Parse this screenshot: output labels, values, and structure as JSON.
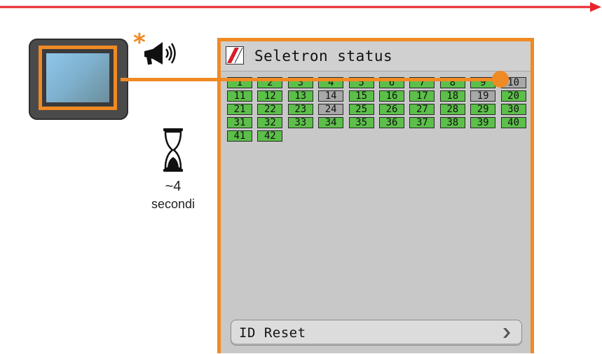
{
  "screen": {
    "title": "Seletron status",
    "reset_button_label": "ID Reset"
  },
  "wait": {
    "value": "~4",
    "unit": "secondi"
  },
  "alert": {
    "symbol": "*"
  },
  "sections": [
    {
      "id": "1",
      "status": "ok"
    },
    {
      "id": "2",
      "status": "ok"
    },
    {
      "id": "3",
      "status": "ok"
    },
    {
      "id": "4",
      "status": "ok"
    },
    {
      "id": "5",
      "status": "ok"
    },
    {
      "id": "6",
      "status": "ok"
    },
    {
      "id": "7",
      "status": "ok"
    },
    {
      "id": "8",
      "status": "ok"
    },
    {
      "id": "9",
      "status": "ok"
    },
    {
      "id": "10",
      "status": "off"
    },
    {
      "id": "11",
      "status": "ok"
    },
    {
      "id": "12",
      "status": "ok"
    },
    {
      "id": "13",
      "status": "ok"
    },
    {
      "id": "14",
      "status": "off"
    },
    {
      "id": "15",
      "status": "ok"
    },
    {
      "id": "16",
      "status": "ok"
    },
    {
      "id": "17",
      "status": "ok"
    },
    {
      "id": "18",
      "status": "ok"
    },
    {
      "id": "19",
      "status": "off"
    },
    {
      "id": "20",
      "status": "ok"
    },
    {
      "id": "21",
      "status": "ok"
    },
    {
      "id": "22",
      "status": "ok"
    },
    {
      "id": "23",
      "status": "ok"
    },
    {
      "id": "24",
      "status": "off"
    },
    {
      "id": "25",
      "status": "ok"
    },
    {
      "id": "26",
      "status": "ok"
    },
    {
      "id": "27",
      "status": "ok"
    },
    {
      "id": "28",
      "status": "ok"
    },
    {
      "id": "29",
      "status": "ok"
    },
    {
      "id": "30",
      "status": "ok"
    },
    {
      "id": "31",
      "status": "ok"
    },
    {
      "id": "32",
      "status": "ok"
    },
    {
      "id": "33",
      "status": "ok"
    },
    {
      "id": "34",
      "status": "ok"
    },
    {
      "id": "35",
      "status": "ok"
    },
    {
      "id": "36",
      "status": "ok"
    },
    {
      "id": "37",
      "status": "ok"
    },
    {
      "id": "38",
      "status": "ok"
    },
    {
      "id": "39",
      "status": "ok"
    },
    {
      "id": "40",
      "status": "ok"
    },
    {
      "id": "41",
      "status": "ok"
    },
    {
      "id": "42",
      "status": "ok"
    }
  ],
  "colors": {
    "accent": "#f08a24",
    "timeline": "#e8242c",
    "section_ok": "#5cbf4a",
    "section_off": "#a8a8a8",
    "screen_bg": "#c8c8c8"
  },
  "icons": {
    "device": "terminal-icon",
    "alert": "megaphone-icon",
    "wait": "hourglass-icon",
    "logo": "brand-logo-icon",
    "button": "chevron-right-icon"
  }
}
